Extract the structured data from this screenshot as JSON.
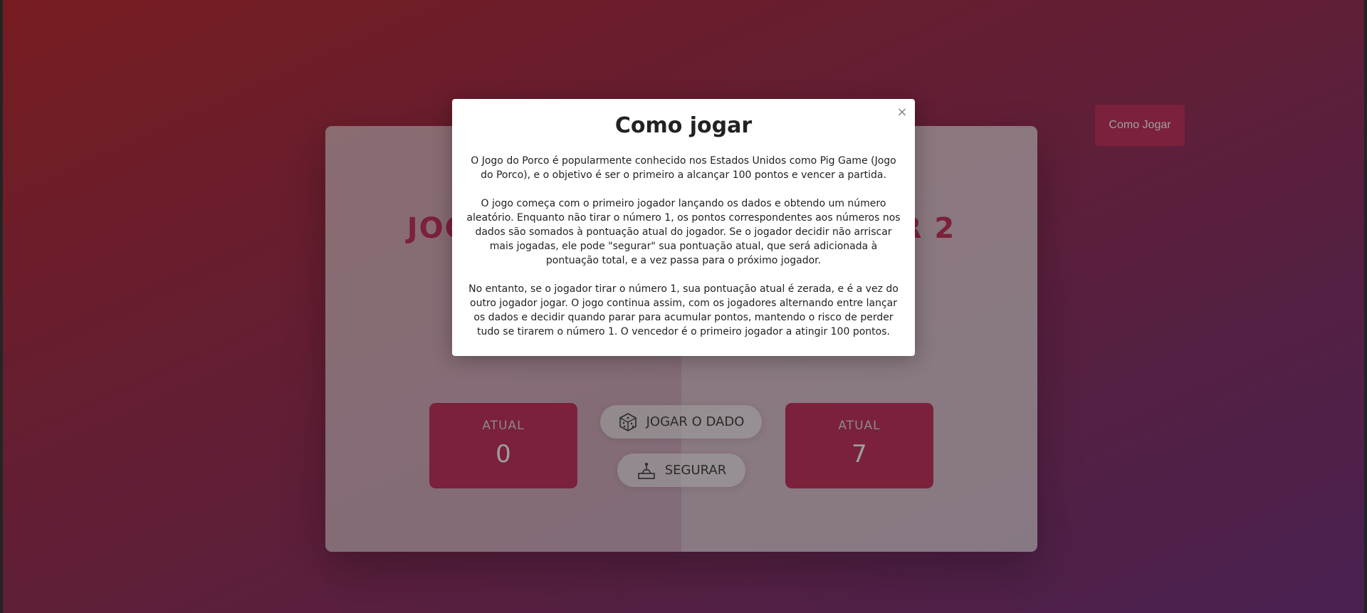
{
  "how_to_play_button": {
    "label": "Como Jogar"
  },
  "players": [
    {
      "name": "JOGADOR 1",
      "score": "",
      "current_label": "ATUAL",
      "current_score": "0"
    },
    {
      "name": "JOGADOR 2",
      "score": "",
      "current_label": "ATUAL",
      "current_score": "7"
    }
  ],
  "controls": {
    "roll_label": "JOGAR O DADO",
    "hold_label": "SEGURAR"
  },
  "modal": {
    "title": "Como jogar",
    "close": "×",
    "paragraphs": [
      "O Jogo do Porco é popularmente conhecido nos Estados Unidos como Pig Game (Jogo do Porco), e o objetivo é ser o primeiro a alcançar 100 pontos e vencer a partida.",
      "O jogo começa com o primeiro jogador lançando os dados e obtendo um número aleatório. Enquanto não tirar o número 1, os pontos correspondentes aos números nos dados são somados à pontuação atual do jogador. Se o jogador decidir não arriscar mais jogadas, ele pode \"segurar\" sua pontuação atual, que será adicionada à pontuação total, e a vez passa para o próximo jogador.",
      "No entanto, se o jogador tirar o número 1, sua pontuação atual é zerada, e é a vez do outro jogador jogar. O jogo continua assim, com os jogadores alternando entre lançar os dados e decidir quando parar para acumular pontos, mantendo o risco de perder tudo se tirarem o número 1. O vencedor é o primeiro jogador a atingir 100 pontos."
    ]
  },
  "colors": {
    "accent": "#c7365f",
    "gradient_start": "#bf2e34",
    "gradient_end": "#753682"
  },
  "icons": {
    "roll": "dice-icon",
    "hold": "hold-lever-icon"
  }
}
